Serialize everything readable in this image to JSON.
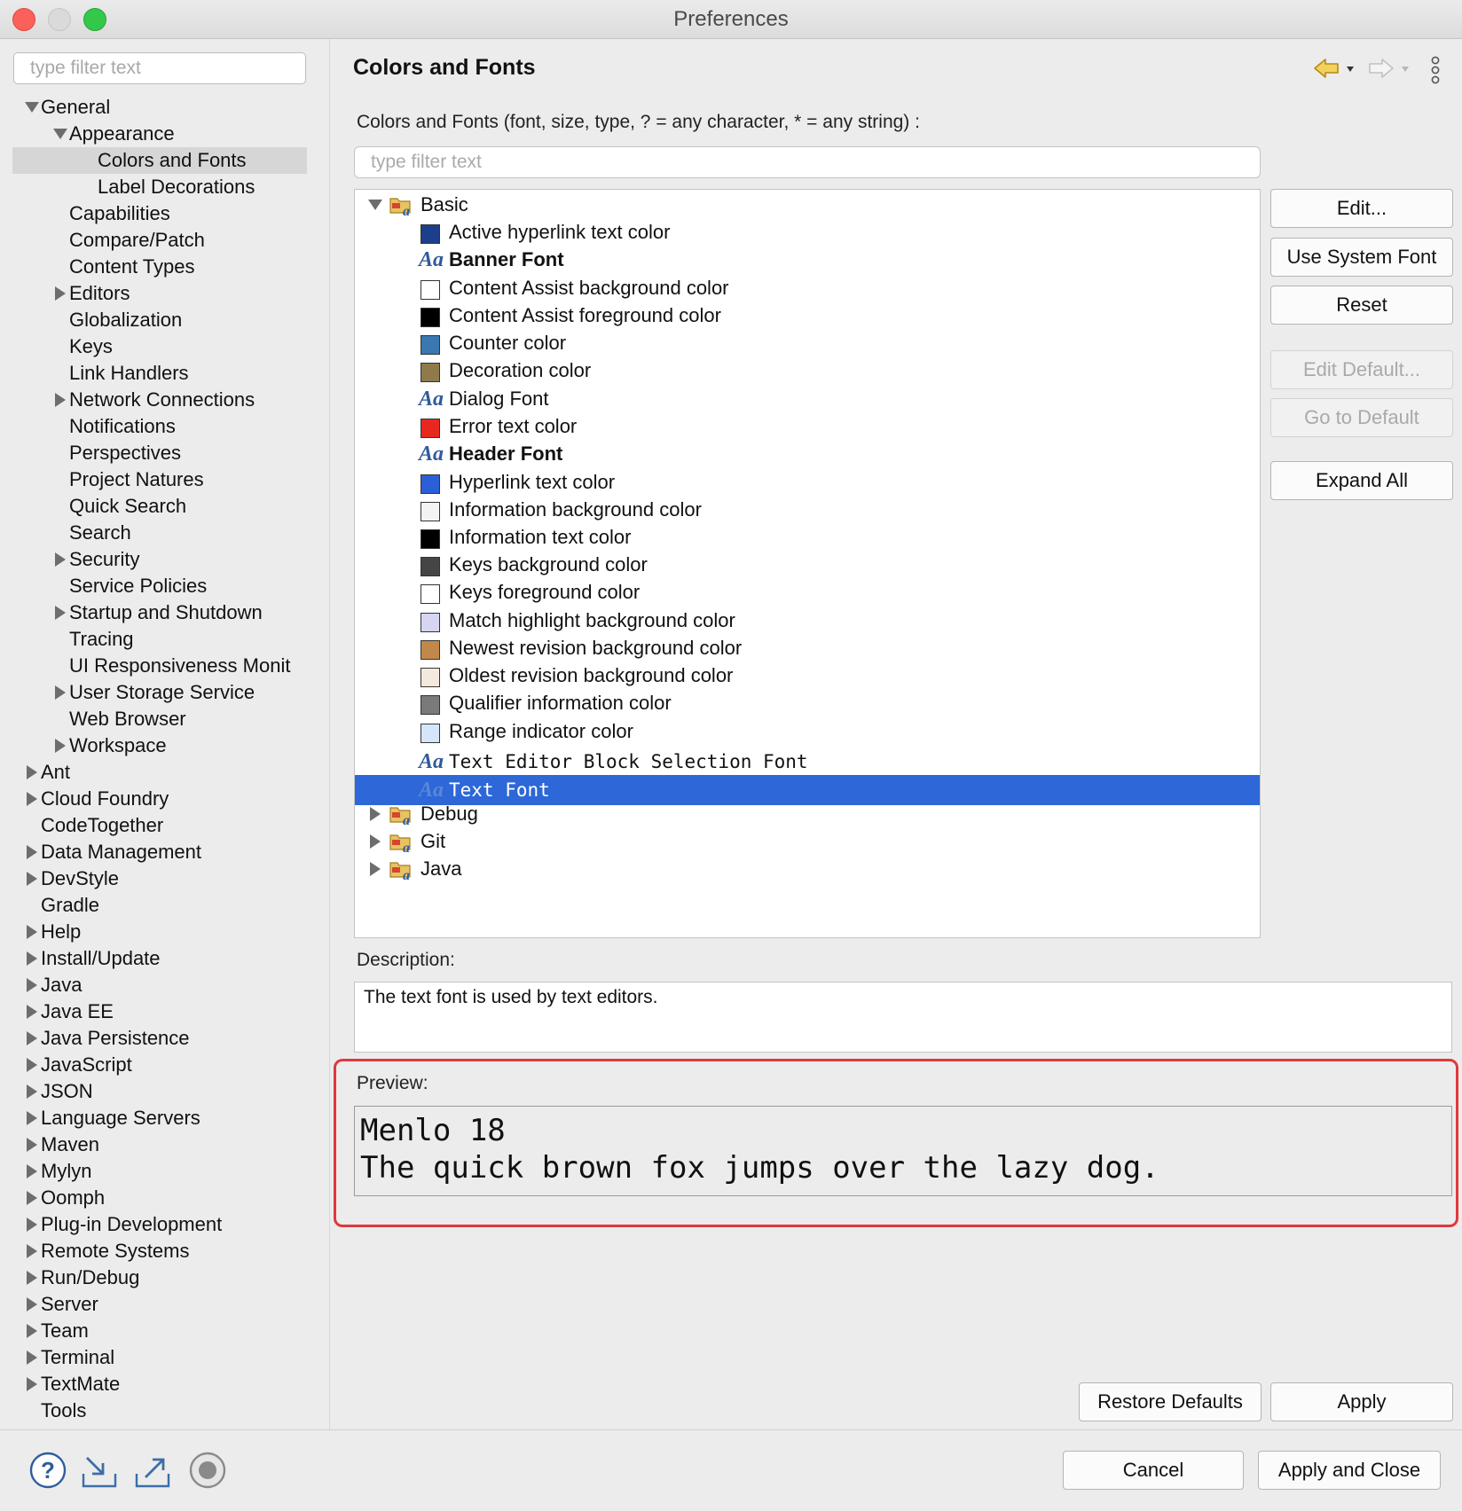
{
  "window": {
    "title": "Preferences"
  },
  "left": {
    "filter_placeholder": "type filter text",
    "items": [
      {
        "label": "General",
        "indent": 0,
        "twisty": "down"
      },
      {
        "label": "Appearance",
        "indent": 1,
        "twisty": "down"
      },
      {
        "label": "Colors and Fonts",
        "indent": 2,
        "twisty": "none",
        "selected": true
      },
      {
        "label": "Label Decorations",
        "indent": 2,
        "twisty": "none"
      },
      {
        "label": "Capabilities",
        "indent": 1,
        "twisty": "none"
      },
      {
        "label": "Compare/Patch",
        "indent": 1,
        "twisty": "none"
      },
      {
        "label": "Content Types",
        "indent": 1,
        "twisty": "none"
      },
      {
        "label": "Editors",
        "indent": 1,
        "twisty": "right"
      },
      {
        "label": "Globalization",
        "indent": 1,
        "twisty": "none"
      },
      {
        "label": "Keys",
        "indent": 1,
        "twisty": "none"
      },
      {
        "label": "Link Handlers",
        "indent": 1,
        "twisty": "none"
      },
      {
        "label": "Network Connections",
        "indent": 1,
        "twisty": "right"
      },
      {
        "label": "Notifications",
        "indent": 1,
        "twisty": "none"
      },
      {
        "label": "Perspectives",
        "indent": 1,
        "twisty": "none"
      },
      {
        "label": "Project Natures",
        "indent": 1,
        "twisty": "none"
      },
      {
        "label": "Quick Search",
        "indent": 1,
        "twisty": "none"
      },
      {
        "label": "Search",
        "indent": 1,
        "twisty": "none"
      },
      {
        "label": "Security",
        "indent": 1,
        "twisty": "right"
      },
      {
        "label": "Service Policies",
        "indent": 1,
        "twisty": "none"
      },
      {
        "label": "Startup and Shutdown",
        "indent": 1,
        "twisty": "right"
      },
      {
        "label": "Tracing",
        "indent": 1,
        "twisty": "none"
      },
      {
        "label": "UI Responsiveness Monit",
        "indent": 1,
        "twisty": "none"
      },
      {
        "label": "User Storage Service",
        "indent": 1,
        "twisty": "right"
      },
      {
        "label": "Web Browser",
        "indent": 1,
        "twisty": "none"
      },
      {
        "label": "Workspace",
        "indent": 1,
        "twisty": "right"
      },
      {
        "label": "Ant",
        "indent": 0,
        "twisty": "right"
      },
      {
        "label": "Cloud Foundry",
        "indent": 0,
        "twisty": "right"
      },
      {
        "label": "CodeTogether",
        "indent": 0,
        "twisty": "none"
      },
      {
        "label": "Data Management",
        "indent": 0,
        "twisty": "right"
      },
      {
        "label": "DevStyle",
        "indent": 0,
        "twisty": "right"
      },
      {
        "label": "Gradle",
        "indent": 0,
        "twisty": "none"
      },
      {
        "label": "Help",
        "indent": 0,
        "twisty": "right"
      },
      {
        "label": "Install/Update",
        "indent": 0,
        "twisty": "right"
      },
      {
        "label": "Java",
        "indent": 0,
        "twisty": "right"
      },
      {
        "label": "Java EE",
        "indent": 0,
        "twisty": "right"
      },
      {
        "label": "Java Persistence",
        "indent": 0,
        "twisty": "right"
      },
      {
        "label": "JavaScript",
        "indent": 0,
        "twisty": "right"
      },
      {
        "label": "JSON",
        "indent": 0,
        "twisty": "right"
      },
      {
        "label": "Language Servers",
        "indent": 0,
        "twisty": "right"
      },
      {
        "label": "Maven",
        "indent": 0,
        "twisty": "right"
      },
      {
        "label": "Mylyn",
        "indent": 0,
        "twisty": "right"
      },
      {
        "label": "Oomph",
        "indent": 0,
        "twisty": "right"
      },
      {
        "label": "Plug-in Development",
        "indent": 0,
        "twisty": "right"
      },
      {
        "label": "Remote Systems",
        "indent": 0,
        "twisty": "right"
      },
      {
        "label": "Run/Debug",
        "indent": 0,
        "twisty": "right"
      },
      {
        "label": "Server",
        "indent": 0,
        "twisty": "right"
      },
      {
        "label": "Team",
        "indent": 0,
        "twisty": "right"
      },
      {
        "label": "Terminal",
        "indent": 0,
        "twisty": "right"
      },
      {
        "label": "TextMate",
        "indent": 0,
        "twisty": "right"
      },
      {
        "label": "Tools",
        "indent": 0,
        "twisty": "none"
      }
    ]
  },
  "main": {
    "title": "Colors and Fonts",
    "filter_label": "Colors and Fonts (font, size, type, ? = any character, * = any string) :",
    "filter_placeholder": "type filter text",
    "tree": [
      {
        "type": "category",
        "label": "Basic",
        "expanded": true
      },
      {
        "type": "color",
        "label": "Active hyperlink text color",
        "color": "#1c3f8c"
      },
      {
        "type": "font",
        "label": "Banner Font",
        "style": "bold"
      },
      {
        "type": "color",
        "label": "Content Assist background color",
        "color": "#ffffff"
      },
      {
        "type": "color",
        "label": "Content Assist foreground color",
        "color": "#000000"
      },
      {
        "type": "color",
        "label": "Counter color",
        "color": "#3978b0"
      },
      {
        "type": "color",
        "label": "Decoration color",
        "color": "#8e7a4a"
      },
      {
        "type": "font",
        "label": "Dialog Font",
        "style": "normal"
      },
      {
        "type": "color",
        "label": "Error text color",
        "color": "#e8281e"
      },
      {
        "type": "font",
        "label": "Header Font",
        "style": "bold"
      },
      {
        "type": "color",
        "label": "Hyperlink text color",
        "color": "#2b5fd8"
      },
      {
        "type": "color",
        "label": "Information background color",
        "color": "#f3f3f3"
      },
      {
        "type": "color",
        "label": "Information text color",
        "color": "#000000"
      },
      {
        "type": "color",
        "label": "Keys background color",
        "color": "#454545"
      },
      {
        "type": "color",
        "label": "Keys foreground color",
        "color": "#ffffff"
      },
      {
        "type": "color",
        "label": "Match highlight background color",
        "color": "#d6d6f2"
      },
      {
        "type": "color",
        "label": "Newest revision background color",
        "color": "#c0894a"
      },
      {
        "type": "color",
        "label": "Oldest revision background color",
        "color": "#f4e9dc"
      },
      {
        "type": "color",
        "label": "Qualifier information color",
        "color": "#7a7a7a"
      },
      {
        "type": "color",
        "label": "Range indicator color",
        "color": "#d6e6fa"
      },
      {
        "type": "font",
        "label": "Text Editor Block Selection Font",
        "style": "mono"
      },
      {
        "type": "font",
        "label": "Text Font",
        "style": "mono",
        "selected": true
      },
      {
        "type": "category",
        "label": "Debug",
        "expanded": false
      },
      {
        "type": "category",
        "label": "Git",
        "expanded": false
      },
      {
        "type": "category",
        "label": "Java",
        "expanded": false
      }
    ],
    "buttons": {
      "edit": "Edit...",
      "use_system_font": "Use System Font",
      "reset": "Reset",
      "edit_default": "Edit Default...",
      "go_to_default": "Go to Default",
      "expand_all": "Expand All"
    },
    "description_label": "Description:",
    "description_text": "The text font is used by text editors.",
    "preview_label": "Preview:",
    "preview_line1": "Menlo 18",
    "preview_line2": "The quick brown fox jumps over the lazy dog.",
    "restore_defaults": "Restore Defaults",
    "apply": "Apply"
  },
  "footer": {
    "cancel": "Cancel",
    "apply_and_close": "Apply and Close",
    "icons": [
      "help-icon",
      "import-icon",
      "export-icon",
      "record-icon"
    ]
  },
  "colors": {
    "selection": "#2d67d8",
    "highlight_border": "#e0383e"
  }
}
